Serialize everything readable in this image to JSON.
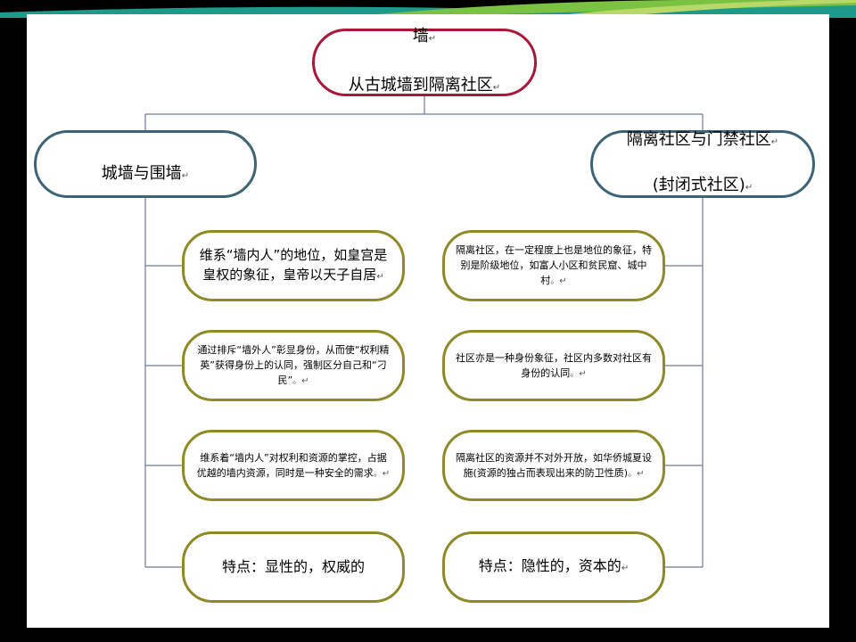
{
  "title": {
    "line1": "墙",
    "line2": "从古城墙到隔离社区"
  },
  "branches": {
    "left": {
      "label": "城墙与围墙"
    },
    "right": {
      "line1": "隔离社区与门禁社区",
      "line2": "(封闭式社区)"
    }
  },
  "left_leaves": [
    {
      "text": "维系“墙内人”的地位，如皇宫是皇权的象征，皇帝以天子自居"
    },
    {
      "text": "通过排斥“墙外人”彰显身份，从而使“权利精英”获得身份上的认同，强制区分自己和“刁民”"
    },
    {
      "text": "维系着“墙内人”对权利和资源的掌控，占据优越的墙内资源，同时是一种安全的需求"
    },
    {
      "text": "特点：显性的，权威的"
    }
  ],
  "right_leaves": [
    {
      "text": "隔离社区，在一定程度上也是地位的象征，特别是阶级地位，如富人小区和贫民窟、城中村"
    },
    {
      "text": "社区亦是一种身份象征，社区内多数对社区有身份的认同"
    },
    {
      "text": "隔离社区的资源并不对外开放，如华侨城夏设施(资源的独占而表现出来的防卫性质)"
    },
    {
      "text": "特点：隐性的，资本的"
    }
  ],
  "marks": {
    "return": "↵",
    "period": "。"
  },
  "colors": {
    "title_border": "#a8183a",
    "branch_border": "#3e6374",
    "leaf_border": "#8f8a28",
    "connector": "#6e7a9c",
    "band_teal": "#1c9a8a",
    "band_green": "#7cc242"
  }
}
